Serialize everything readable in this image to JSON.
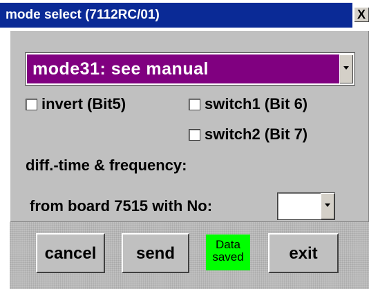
{
  "window": {
    "title": "mode select (7112RC/01)",
    "close_label": "X"
  },
  "mode": {
    "selected": "mode31: see manual"
  },
  "options": {
    "invert_label": "invert (Bit5)",
    "switch1_label": "switch1 (Bit 6)",
    "switch2_label": "switch2 (Bit 7)",
    "invert_checked": false,
    "switch1_checked": false,
    "switch2_checked": false
  },
  "diff_time_label": "diff.-time & frequency:",
  "board": {
    "label": "from board 7515 with No:",
    "selected": ""
  },
  "buttons": {
    "cancel": "cancel",
    "send": "send",
    "exit": "exit"
  },
  "status": {
    "line1": "Data",
    "line2": "saved"
  },
  "colors": {
    "titlebar": "#0a2a96",
    "mode_background": "#800080",
    "status_background": "#00ff00",
    "panel": "#c0c0c0"
  }
}
